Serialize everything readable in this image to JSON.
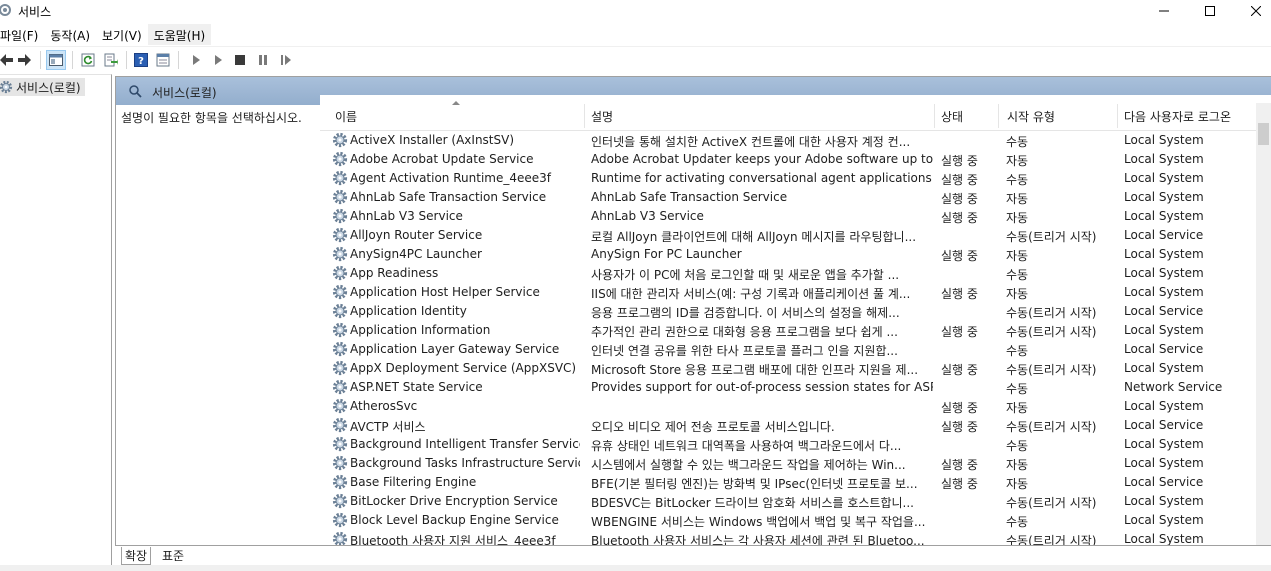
{
  "window": {
    "title": "서비스"
  },
  "menu": [
    "파일(F)",
    "동작(A)",
    "보기(V)",
    "도움말(H)"
  ],
  "tree": {
    "root_label": "서비스(로컬)"
  },
  "main": {
    "header_label": "서비스(로컬)",
    "description_prompt": "설명이 필요한 항목을 선택하십시오."
  },
  "columns": {
    "name": "이름",
    "description": "설명",
    "status": "상태",
    "startup": "시작 유형",
    "logon": "다음 사용자로 로그온"
  },
  "services": [
    {
      "name": "ActiveX Installer (AxInstSV)",
      "desc": "인터넷을 통해 설치한 ActiveX 컨트롤에 대한 사용자 계정 컨...",
      "status": "",
      "startup": "수동",
      "logon": "Local System"
    },
    {
      "name": "Adobe Acrobat Update Service",
      "desc": "Adobe Acrobat Updater keeps your Adobe software up to da...",
      "status": "실행 중",
      "startup": "자동",
      "logon": "Local System"
    },
    {
      "name": "Agent Activation Runtime_4eee3f",
      "desc": "Runtime for activating conversational agent applications",
      "status": "실행 중",
      "startup": "수동",
      "logon": "Local System"
    },
    {
      "name": "AhnLab Safe Transaction Service",
      "desc": "AhnLab Safe Transaction Service",
      "status": "실행 중",
      "startup": "자동",
      "logon": "Local System"
    },
    {
      "name": "AhnLab V3 Service",
      "desc": "AhnLab V3 Service",
      "status": "실행 중",
      "startup": "자동",
      "logon": "Local System"
    },
    {
      "name": "AllJoyn Router Service",
      "desc": "로컬 AllJoyn 클라이언트에 대해 AllJoyn 메시지를 라우팅합니...",
      "status": "",
      "startup": "수동(트리거 시작)",
      "logon": "Local Service"
    },
    {
      "name": "AnySign4PC Launcher",
      "desc": "AnySign For PC Launcher",
      "status": "실행 중",
      "startup": "자동",
      "logon": "Local System"
    },
    {
      "name": "App Readiness",
      "desc": "사용자가 이 PC에 처음 로그인할 때 및 새로운 앱을 추가할 ...",
      "status": "",
      "startup": "수동",
      "logon": "Local System"
    },
    {
      "name": "Application Host Helper Service",
      "desc": "IIS에 대한 관리자 서비스(예: 구성 기록과 애플리케이션 풀 계...",
      "status": "실행 중",
      "startup": "자동",
      "logon": "Local System"
    },
    {
      "name": "Application Identity",
      "desc": "응용 프로그램의 ID를 검증합니다. 이 서비스의 설정을 해제...",
      "status": "",
      "startup": "수동(트리거 시작)",
      "logon": "Local Service"
    },
    {
      "name": "Application Information",
      "desc": "추가적인 관리 권한으로 대화형 응용 프로그램을 보다 쉽게 ...",
      "status": "실행 중",
      "startup": "수동(트리거 시작)",
      "logon": "Local System"
    },
    {
      "name": "Application Layer Gateway Service",
      "desc": "인터넷 연결 공유를 위한 타사 프로토콜 플러그 인을 지원합...",
      "status": "",
      "startup": "수동",
      "logon": "Local Service"
    },
    {
      "name": "AppX Deployment Service (AppXSVC)",
      "desc": "Microsoft Store 응용 프로그램 배포에 대한 인프라 지원을 제...",
      "status": "실행 중",
      "startup": "수동(트리거 시작)",
      "logon": "Local System"
    },
    {
      "name": "ASP.NET State Service",
      "desc": "Provides support for out-of-process session states for ASP.N...",
      "status": "",
      "startup": "수동",
      "logon": "Network Service"
    },
    {
      "name": "AtherosSvc",
      "desc": "",
      "status": "실행 중",
      "startup": "자동",
      "logon": "Local System"
    },
    {
      "name": "AVCTP 서비스",
      "desc": "오디오 비디오 제어 전송 프로토콜 서비스입니다.",
      "status": "실행 중",
      "startup": "수동(트리거 시작)",
      "logon": "Local Service"
    },
    {
      "name": "Background Intelligent Transfer Service",
      "desc": "유휴 상태인 네트워크 대역폭을 사용하여 백그라운드에서 다...",
      "status": "",
      "startup": "수동",
      "logon": "Local System"
    },
    {
      "name": "Background Tasks Infrastructure Service",
      "desc": "시스템에서 실행할 수 있는 백그라운드 작업을 제어하는 Win...",
      "status": "실행 중",
      "startup": "자동",
      "logon": "Local System"
    },
    {
      "name": "Base Filtering Engine",
      "desc": "BFE(기본 필터링 엔진)는 방화벽 및 IPsec(인터넷 프로토콜 보...",
      "status": "실행 중",
      "startup": "자동",
      "logon": "Local Service"
    },
    {
      "name": "BitLocker Drive Encryption Service",
      "desc": "BDESVC는 BitLocker 드라이브 암호화 서비스를 호스트합니...",
      "status": "",
      "startup": "수동(트리거 시작)",
      "logon": "Local System"
    },
    {
      "name": "Block Level Backup Engine Service",
      "desc": "WBENGINE 서비스는 Windows 백업에서 백업 및 복구 작업을...",
      "status": "",
      "startup": "수동",
      "logon": "Local System"
    },
    {
      "name": "Bluetooth 사용자 지원 서비스_4eee3f",
      "desc": "Bluetooth 사용자 서비스는 각 사용자 세션에 관련 된 Bluetoo...",
      "status": "",
      "startup": "수동(트리거 시작)",
      "logon": "Local System"
    }
  ],
  "tabs": {
    "extended": "확장",
    "standard": "표준"
  },
  "icons": [
    "app-icon",
    "back-arrow-icon",
    "forward-arrow-icon",
    "console-tree-icon",
    "refresh-icon",
    "export-list-icon",
    "help-icon",
    "properties-icon",
    "start-icon",
    "start-alt-icon",
    "stop-icon",
    "pause-icon",
    "restart-icon",
    "gear-icon"
  ]
}
